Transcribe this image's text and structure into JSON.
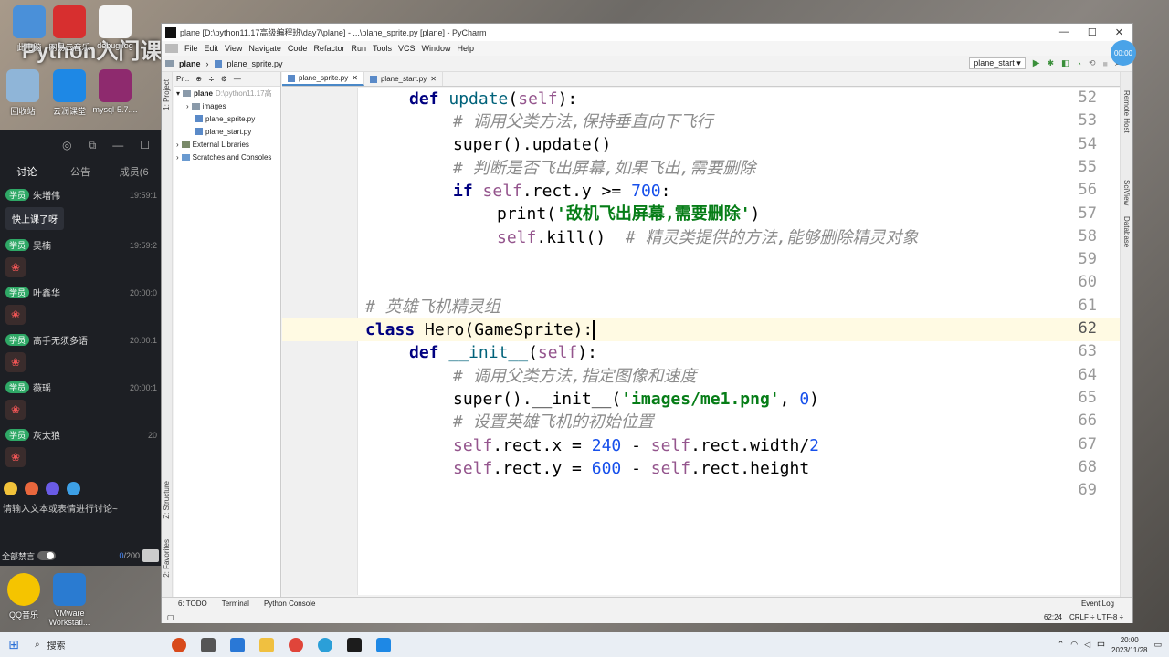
{
  "desktop": {
    "banner": "Python入门课",
    "icons": [
      {
        "label": "此电脑"
      },
      {
        "label": "网易云音乐"
      },
      {
        "label": "debug.log"
      },
      {
        "label": "回收站"
      },
      {
        "label": "云润课堂"
      },
      {
        "label": "mysql-5.7...."
      },
      {
        "label": "QQ音乐"
      },
      {
        "label": "VMware Workstati..."
      }
    ]
  },
  "chat": {
    "tabs": [
      "讨论",
      "公告",
      "成员(6"
    ],
    "messages": [
      {
        "role": "学员",
        "name": "朱増伟",
        "time": "19:59:1",
        "text": "快上课了呀"
      },
      {
        "role": "学员",
        "name": "吴楠",
        "time": "19:59:2",
        "text": ""
      },
      {
        "role": "学员",
        "name": "叶鑫华",
        "time": "20:00:0",
        "text": ""
      },
      {
        "role": "学员",
        "name": "高手无须多语",
        "time": "20:00:1",
        "text": ""
      },
      {
        "role": "学员",
        "name": "薇瑶",
        "time": "20:00:1",
        "text": ""
      },
      {
        "role": "学员",
        "name": "灰太狼",
        "time": "20",
        "text": ""
      }
    ],
    "input_placeholder": "请输入文本或表情进行讨论~",
    "mute_all": "全部禁言",
    "count_current": "0",
    "count_max": "/200"
  },
  "ide": {
    "title": "plane [D:\\python11.17高级编程班\\day7\\plane] - ...\\plane_sprite.py [plane] - PyCharm",
    "menu": [
      "File",
      "Edit",
      "View",
      "Navigate",
      "Code",
      "Refactor",
      "Run",
      "Tools",
      "VCS",
      "Window",
      "Help"
    ],
    "breadcrumb": [
      "plane",
      "plane_sprite.py"
    ],
    "run_config": "plane_start",
    "project_header": "Pr...",
    "tree": [
      {
        "label": "plane",
        "extra": "D:\\python11.17高",
        "indent": 0
      },
      {
        "label": "images",
        "extra": "",
        "indent": 1
      },
      {
        "label": "plane_sprite.py",
        "extra": "",
        "indent": 1
      },
      {
        "label": "plane_start.py",
        "extra": "",
        "indent": 1
      },
      {
        "label": "External Libraries",
        "extra": "",
        "indent": 0
      },
      {
        "label": "Scratches and Consoles",
        "extra": "",
        "indent": 0
      }
    ],
    "tabs": [
      "plane_sprite.py",
      "plane_start.py"
    ],
    "left_tools": [
      "1: Project",
      "Z: Structure",
      "2: Favorites"
    ],
    "right_tools": [
      "Remote Host",
      "SciView",
      "Database"
    ],
    "bottom_tools": [
      "6: TODO",
      "Terminal",
      "Python Console"
    ],
    "event_log": "Event Log",
    "status_pos": "62:24",
    "status_enc": "CRLF ÷  UTF-8 ÷",
    "timer": "00:00"
  },
  "code": {
    "line_numbers": [
      "52",
      "53",
      "54",
      "55",
      "56",
      "57",
      "58",
      "59",
      "60",
      "61",
      "62",
      "63",
      "64",
      "65",
      "66",
      "67",
      "68",
      "69"
    ],
    "current_line_index": 10
  },
  "taskbar": {
    "search": "搜索",
    "time": "20:00",
    "date": "2023/11/28",
    "ime": "中"
  }
}
